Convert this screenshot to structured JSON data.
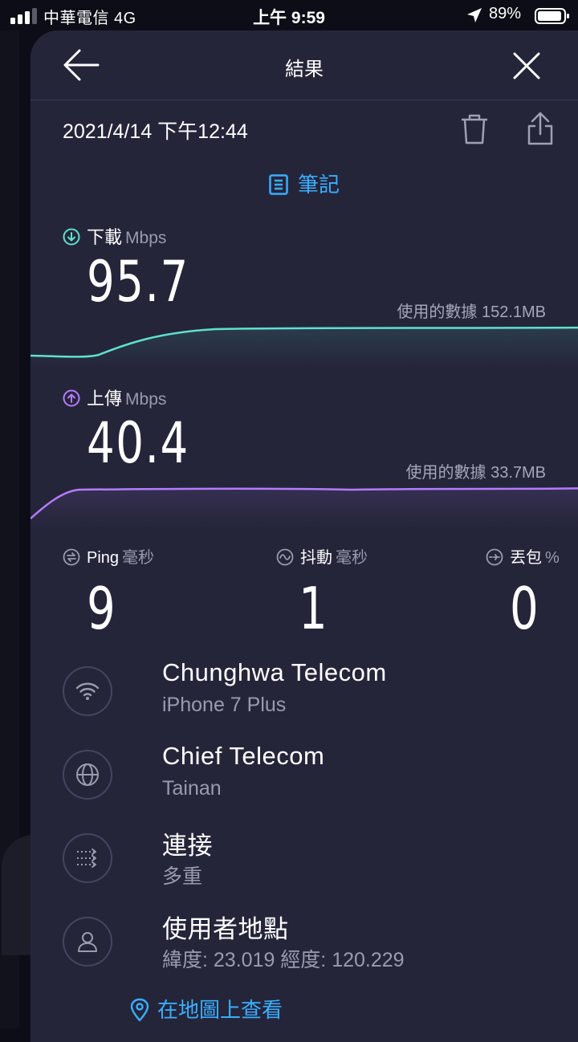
{
  "status_bar": {
    "carrier": "中華電信  4G",
    "time": "上午 9:59",
    "battery_pct": "89%"
  },
  "header": {
    "title": "結果",
    "back_icon": "back-arrow-icon",
    "close_icon": "close-icon"
  },
  "result": {
    "datetime": "2021/4/14 下午12:44",
    "notes_label": "筆記"
  },
  "download": {
    "label": "下載",
    "unit": "Mbps",
    "value": "95.7",
    "data_used": "使用的數據 152.1MB",
    "color": "#5ee0d0"
  },
  "upload": {
    "label": "上傳",
    "unit": "Mbps",
    "value": "40.4",
    "data_used": "使用的數據 33.7MB",
    "color": "#b57bff"
  },
  "ping": {
    "label": "Ping",
    "unit": "毫秒",
    "value": "9"
  },
  "jitter": {
    "label": "抖動",
    "unit": "毫秒",
    "value": "1"
  },
  "loss": {
    "label": "丟包",
    "unit": "%",
    "value": "0"
  },
  "provider": {
    "name": "Chunghwa Telecom",
    "device": "iPhone 7 Plus"
  },
  "server": {
    "name": "Chief Telecom",
    "city": "Tainan"
  },
  "connection": {
    "label": "連接",
    "value": "多重"
  },
  "location": {
    "label": "使用者地點",
    "coords": "緯度: 23.019  經度: 120.229"
  },
  "map_link": "在地圖上查看",
  "colors": {
    "accent": "#3aaeff",
    "sheet": "#25253a",
    "background": "#0d0d17"
  }
}
